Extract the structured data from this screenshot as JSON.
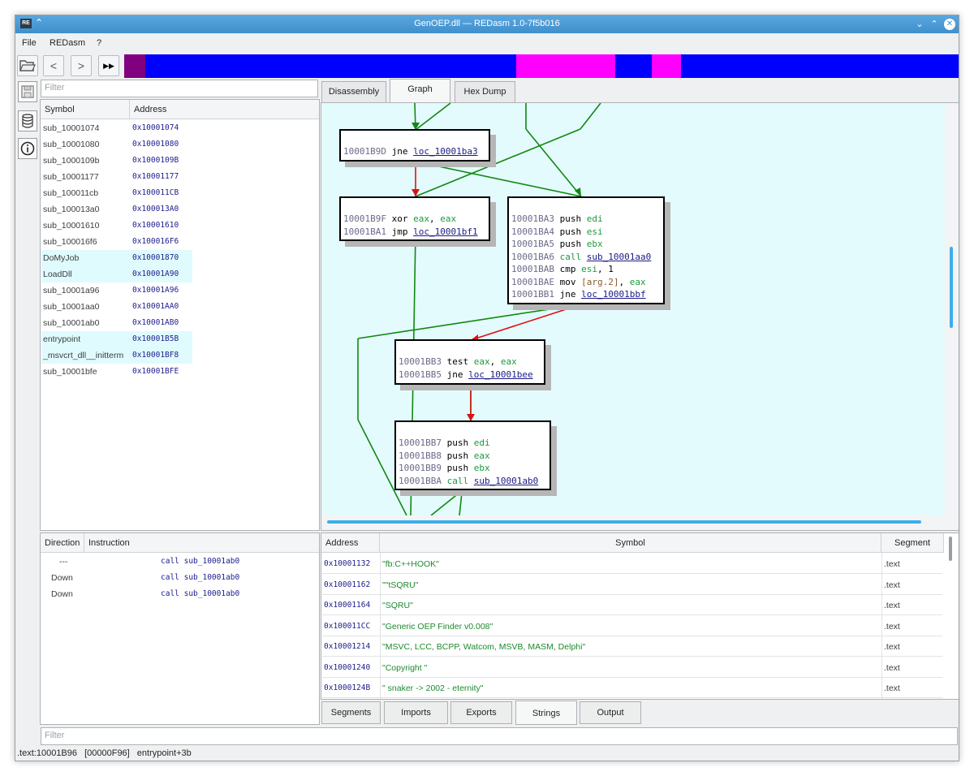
{
  "window": {
    "title": "GenOEP.dll — REDasm 1.0-7f5b016",
    "app_badge": "RE"
  },
  "menu": [
    "File",
    "REDasm",
    "?"
  ],
  "toolbar": {
    "back": "<",
    "forward": ">",
    "run": "▶▶"
  },
  "navbar_colors": {
    "base": "#0000ff",
    "purple": "#800080",
    "magenta": "#ff00ff"
  },
  "symbols": {
    "filter_placeholder": "Filter",
    "headers": {
      "symbol": "Symbol",
      "address": "Address"
    },
    "rows": [
      {
        "name": "sub_10001074",
        "addr": "0x10001074",
        "hl": false
      },
      {
        "name": "sub_10001080",
        "addr": "0x10001080",
        "hl": false
      },
      {
        "name": "sub_1000109b",
        "addr": "0x1000109B",
        "hl": false
      },
      {
        "name": "sub_10001177",
        "addr": "0x10001177",
        "hl": false
      },
      {
        "name": "sub_100011cb",
        "addr": "0x100011CB",
        "hl": false
      },
      {
        "name": "sub_100013a0",
        "addr": "0x100013A0",
        "hl": false
      },
      {
        "name": "sub_10001610",
        "addr": "0x10001610",
        "hl": false
      },
      {
        "name": "sub_100016f6",
        "addr": "0x100016F6",
        "hl": false
      },
      {
        "name": "DoMyJob",
        "addr": "0x10001870",
        "hl": true
      },
      {
        "name": "LoadDll",
        "addr": "0x10001A90",
        "hl": true
      },
      {
        "name": "sub_10001a96",
        "addr": "0x10001A96",
        "hl": false
      },
      {
        "name": "sub_10001aa0",
        "addr": "0x10001AA0",
        "hl": false
      },
      {
        "name": "sub_10001ab0",
        "addr": "0x10001AB0",
        "hl": false
      },
      {
        "name": "entrypoint",
        "addr": "0x10001B5B",
        "hl": true
      },
      {
        "name": "_msvcrt_dll__initterm",
        "addr": "0x10001BF8",
        "hl": true
      },
      {
        "name": "sub_10001bfe",
        "addr": "0x10001BFE",
        "hl": false
      }
    ]
  },
  "tabs": [
    "Disassembly",
    "Graph",
    "Hex Dump"
  ],
  "graph": {
    "node1": [
      {
        "a": "10001B9D",
        "m": "jne",
        "ops": [
          {
            "t": "loc_10001ba3",
            "c": "lnk"
          }
        ]
      }
    ],
    "node2": [
      {
        "a": "10001B9F",
        "m": "xor",
        "ops": [
          {
            "t": "eax",
            "c": "rg"
          },
          {
            "t": ", ",
            "c": "mn"
          },
          {
            "t": "eax",
            "c": "rg"
          }
        ]
      },
      {
        "a": "10001BA1",
        "m": "jmp",
        "ops": [
          {
            "t": "loc_10001bf1",
            "c": "lnk"
          }
        ]
      }
    ],
    "node3": [
      {
        "a": "10001BA3",
        "m": "push",
        "ops": [
          {
            "t": "edi",
            "c": "rg"
          }
        ]
      },
      {
        "a": "10001BA4",
        "m": "push",
        "ops": [
          {
            "t": "esi",
            "c": "rg"
          }
        ]
      },
      {
        "a": "10001BA5",
        "m": "push",
        "ops": [
          {
            "t": "ebx",
            "c": "rg"
          }
        ]
      },
      {
        "a": "10001BA6",
        "m": "call",
        "mc": "nb",
        "ops": [
          {
            "t": "sub_10001aa0",
            "c": "lnk"
          }
        ]
      },
      {
        "a": "10001BAB",
        "m": "cmp",
        "ops": [
          {
            "t": "esi",
            "c": "rg"
          },
          {
            "t": ", 1",
            "c": "num"
          }
        ]
      },
      {
        "a": "10001BAE",
        "m": "mov",
        "ops": [
          {
            "t": "[arg.2]",
            "c": "arg"
          },
          {
            "t": ", ",
            "c": "mn"
          },
          {
            "t": "eax",
            "c": "rg"
          }
        ]
      },
      {
        "a": "10001BB1",
        "m": "jne",
        "ops": [
          {
            "t": "loc_10001bbf",
            "c": "lnk"
          }
        ]
      }
    ],
    "node4": [
      {
        "a": "10001BB3",
        "m": "test",
        "ops": [
          {
            "t": "eax",
            "c": "rg"
          },
          {
            "t": ", ",
            "c": "mn"
          },
          {
            "t": "eax",
            "c": "rg"
          }
        ]
      },
      {
        "a": "10001BB5",
        "m": "jne",
        "ops": [
          {
            "t": "loc_10001bee",
            "c": "lnk"
          }
        ]
      }
    ],
    "node5": [
      {
        "a": "10001BB7",
        "m": "push",
        "ops": [
          {
            "t": "edi",
            "c": "rg"
          }
        ]
      },
      {
        "a": "10001BB8",
        "m": "push",
        "ops": [
          {
            "t": "eax",
            "c": "rg"
          }
        ]
      },
      {
        "a": "10001BB9",
        "m": "push",
        "ops": [
          {
            "t": "ebx",
            "c": "rg"
          }
        ]
      },
      {
        "a": "10001BBA",
        "m": "call",
        "mc": "nb",
        "ops": [
          {
            "t": "sub_10001ab0",
            "c": "lnk"
          }
        ]
      }
    ]
  },
  "xrefs": {
    "headers": {
      "direction": "Direction",
      "instruction": "Instruction"
    },
    "rows": [
      {
        "dir": "---",
        "ins": "call sub_10001ab0"
      },
      {
        "dir": "Down",
        "ins": "call sub_10001ab0"
      },
      {
        "dir": "Down",
        "ins": "call sub_10001ab0"
      }
    ]
  },
  "strings": {
    "headers": {
      "address": "Address",
      "symbol": "Symbol",
      "segment": "Segment"
    },
    "rows": [
      {
        "addr": "0x10001132",
        "sym": "\"fb:C++HOOK\"",
        "seg": ".text"
      },
      {
        "addr": "0x10001162",
        "sym": "\"\"tSQRU\"",
        "seg": ".text"
      },
      {
        "addr": "0x10001164",
        "sym": "\"SQRU\"",
        "seg": ".text"
      },
      {
        "addr": "0x100011CC",
        "sym": "\"Generic OEP Finder v0.008\"",
        "seg": ".text"
      },
      {
        "addr": "0x10001214",
        "sym": "\"MSVC, LCC, BCPP, Watcom, MSVB, MASM, Delphi\"",
        "seg": ".text"
      },
      {
        "addr": "0x10001240",
        "sym": "\"Copyright \"",
        "seg": ".text"
      },
      {
        "addr": "0x1000124B",
        "sym": "\" snaker -> 2002 - eternity\"",
        "seg": ".text"
      }
    ]
  },
  "bottom_tabs": [
    "Segments",
    "Imports",
    "Exports",
    "Strings",
    "Output"
  ],
  "bottom_filter_placeholder": "Filter",
  "status": {
    "location": ".text:10001B96",
    "offset": "[00000F96]",
    "symbol": "entrypoint+3b"
  }
}
